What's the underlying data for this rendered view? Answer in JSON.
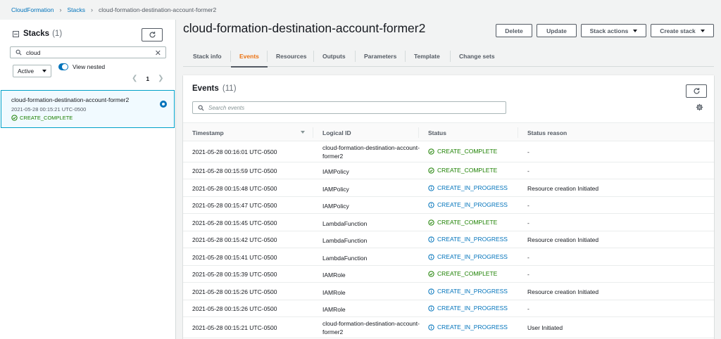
{
  "breadcrumb": {
    "items": [
      "CloudFormation",
      "Stacks"
    ],
    "current": "cloud-formation-destination-account-former2"
  },
  "stacks_panel": {
    "title": "Stacks",
    "count": "(1)",
    "search_value": "cloud",
    "filter_value": "Active",
    "view_nested_label": "View nested",
    "page": "1",
    "stack": {
      "name": "cloud-formation-destination-account-former2",
      "date": "2021-05-28 00:15:21 UTC-0500",
      "status": "CREATE_COMPLETE"
    }
  },
  "main": {
    "title": "cloud-formation-destination-account-former2",
    "buttons": {
      "delete": "Delete",
      "update": "Update",
      "stack_actions": "Stack actions",
      "create_stack": "Create stack"
    },
    "tabs": [
      {
        "label": "Stack info"
      },
      {
        "label": "Events"
      },
      {
        "label": "Resources"
      },
      {
        "label": "Outputs"
      },
      {
        "label": "Parameters"
      },
      {
        "label": "Template"
      },
      {
        "label": "Change sets"
      }
    ],
    "active_tab": "Events"
  },
  "events": {
    "title": "Events",
    "count": "(11)",
    "search_placeholder": "Search events",
    "columns": {
      "timestamp": "Timestamp",
      "logical_id": "Logical ID",
      "status": "Status",
      "status_reason": "Status reason"
    },
    "rows": [
      {
        "timestamp": "2021-05-28 00:16:01 UTC-0500",
        "logical_id": "cloud-formation-destination-account-former2",
        "status": "CREATE_COMPLETE",
        "status_type": "complete",
        "reason": "-"
      },
      {
        "timestamp": "2021-05-28 00:15:59 UTC-0500",
        "logical_id": "IAMPolicy",
        "status": "CREATE_COMPLETE",
        "status_type": "complete",
        "reason": "-"
      },
      {
        "timestamp": "2021-05-28 00:15:48 UTC-0500",
        "logical_id": "IAMPolicy",
        "status": "CREATE_IN_PROGRESS",
        "status_type": "progress",
        "reason": "Resource creation Initiated"
      },
      {
        "timestamp": "2021-05-28 00:15:47 UTC-0500",
        "logical_id": "IAMPolicy",
        "status": "CREATE_IN_PROGRESS",
        "status_type": "progress",
        "reason": "-"
      },
      {
        "timestamp": "2021-05-28 00:15:45 UTC-0500",
        "logical_id": "LambdaFunction",
        "status": "CREATE_COMPLETE",
        "status_type": "complete",
        "reason": "-"
      },
      {
        "timestamp": "2021-05-28 00:15:42 UTC-0500",
        "logical_id": "LambdaFunction",
        "status": "CREATE_IN_PROGRESS",
        "status_type": "progress",
        "reason": "Resource creation Initiated"
      },
      {
        "timestamp": "2021-05-28 00:15:41 UTC-0500",
        "logical_id": "LambdaFunction",
        "status": "CREATE_IN_PROGRESS",
        "status_type": "progress",
        "reason": "-"
      },
      {
        "timestamp": "2021-05-28 00:15:39 UTC-0500",
        "logical_id": "IAMRole",
        "status": "CREATE_COMPLETE",
        "status_type": "complete",
        "reason": "-"
      },
      {
        "timestamp": "2021-05-28 00:15:26 UTC-0500",
        "logical_id": "IAMRole",
        "status": "CREATE_IN_PROGRESS",
        "status_type": "progress",
        "reason": "Resource creation Initiated"
      },
      {
        "timestamp": "2021-05-28 00:15:26 UTC-0500",
        "logical_id": "IAMRole",
        "status": "CREATE_IN_PROGRESS",
        "status_type": "progress",
        "reason": "-"
      },
      {
        "timestamp": "2021-05-28 00:15:21 UTC-0500",
        "logical_id": "cloud-formation-destination-account-former2",
        "status": "CREATE_IN_PROGRESS",
        "status_type": "progress",
        "reason": "User Initiated"
      }
    ]
  },
  "colors": {
    "link": "#0073bb",
    "active_tab": "#ec7211",
    "success": "#1d8102",
    "info": "#0073bb"
  },
  "icons": {
    "refresh": "refresh-icon",
    "search": "search-icon",
    "settings": "gear-icon",
    "complete": "check-circle-icon",
    "in_progress": "info-circle-icon"
  }
}
